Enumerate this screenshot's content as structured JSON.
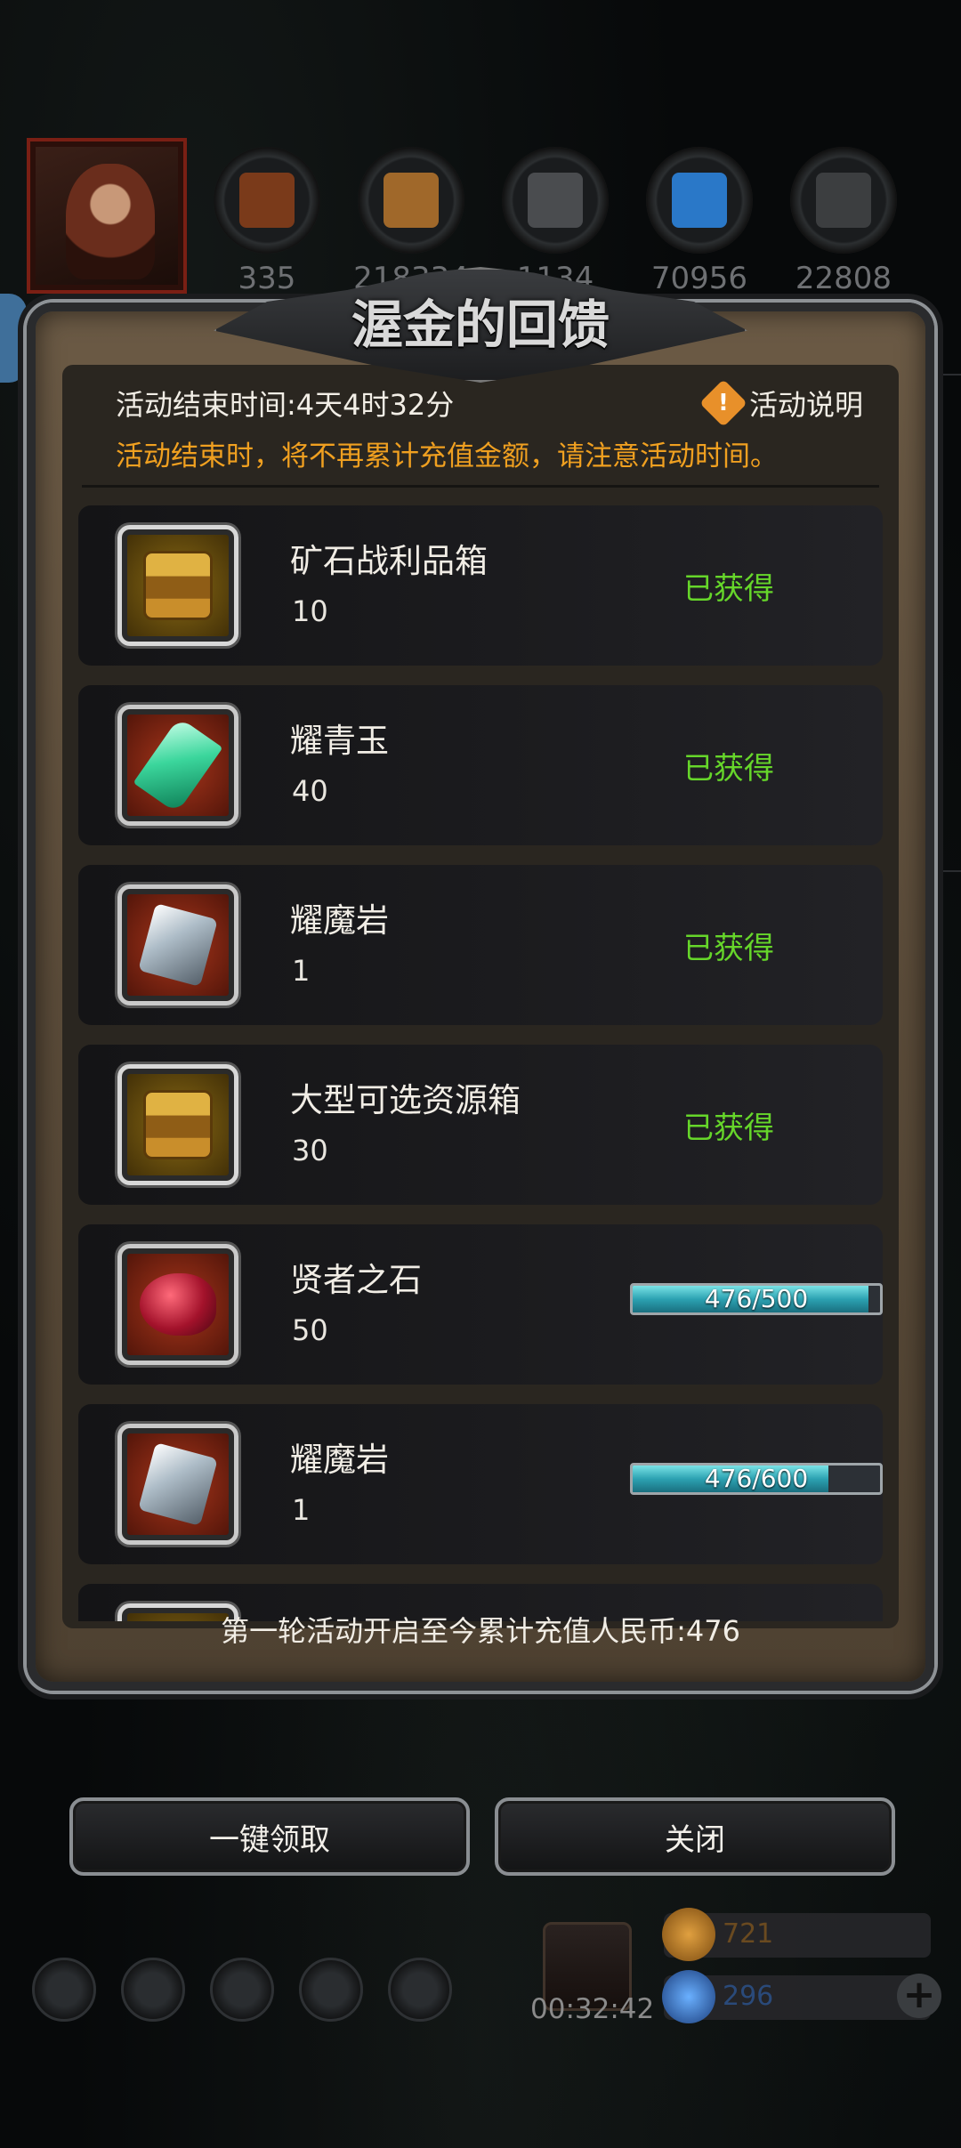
{
  "background": {
    "resources": [
      {
        "name": "wood-resource-icon",
        "value": "335",
        "color": "#7a3a1a"
      },
      {
        "name": "plank-resource-icon",
        "value": "218334",
        "color": "#a0682a"
      },
      {
        "name": "steel-resource-icon",
        "value": "1134",
        "color": "#4a4c4f"
      },
      {
        "name": "crystal-resource-icon",
        "value": "70956",
        "color": "#2a78c8"
      },
      {
        "name": "iron-resource-icon",
        "value": "22808",
        "color": "#3c3e40"
      }
    ],
    "timer": "00:32:42",
    "gold_value": "721",
    "diamond_value": "296"
  },
  "dialog": {
    "title": "渥金的回馈",
    "end_time": "活动结束时间:4天4时32分",
    "explain_label": "活动说明",
    "notice": "活动结束时，将不再累计充值金额，请注意活动时间。",
    "total_recharge": "第一轮活动开启至今累计充值人民币:476"
  },
  "rewards": [
    {
      "name": "矿石战利品箱",
      "qty": "10",
      "status": "已获得",
      "icon": "chest-icon"
    },
    {
      "name": "耀青玉",
      "qty": "40",
      "status": "已获得",
      "icon": "jade-icon"
    },
    {
      "name": "耀魔岩",
      "qty": "1",
      "status": "已获得",
      "icon": "magic-rock-icon"
    },
    {
      "name": "大型可选资源箱",
      "qty": "30",
      "status": "已获得",
      "icon": "chest-icon"
    },
    {
      "name": "贤者之石",
      "qty": "50",
      "progress_text": "476/500",
      "progress": 0.952,
      "icon": "ruby-stone-icon"
    },
    {
      "name": "耀魔岩",
      "qty": "1",
      "progress_text": "476/600",
      "progress": 0.793,
      "icon": "magic-rock-icon"
    },
    {
      "name": "",
      "qty": "",
      "icon": "chest-icon"
    }
  ],
  "buttons": {
    "claim_all": "一键领取",
    "close": "关闭"
  },
  "colors": {
    "received_green": "#66d62a",
    "notice_orange": "#f0a020",
    "progress_cyan": "#2ca2b2"
  }
}
